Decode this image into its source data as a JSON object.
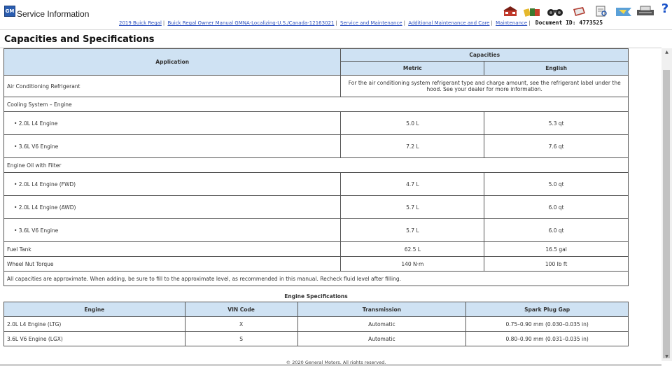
{
  "app": {
    "title": "Service Information",
    "logo": "GM"
  },
  "breadcrumb": {
    "items": [
      "2019 Buick Regal",
      "Buick Regal Owner Manual GMNA-Localizing-U.S./Canada-12163021",
      "Service and Maintenance",
      "Additional Maintenance and Care",
      "Maintenance"
    ],
    "doc_id": "Document ID: 4773525"
  },
  "toolbar": {
    "icons": [
      "home-icon",
      "books-icon",
      "binoculars-icon",
      "book-icon",
      "document-search-icon",
      "flag-icon",
      "printer-icon",
      "help-icon"
    ],
    "help_label": "?"
  },
  "page": {
    "title": "Capacities and Specifications"
  },
  "capacities": {
    "header_application": "Application",
    "header_capacities": "Capacities",
    "header_metric": "Metric",
    "header_english": "English",
    "ac": {
      "label": "Air Conditioning Refrigerant",
      "note": "For the air conditioning system refrigerant type and charge amount, see the refrigerant label under the hood. See your dealer for more information."
    },
    "cooling": {
      "label": "Cooling System – Engine",
      "rows": [
        {
          "label": "• 2.0L L4 Engine",
          "metric": "5.0 L",
          "english": "5.3 qt"
        },
        {
          "label": "• 3.6L V6 Engine",
          "metric": "7.2 L",
          "english": "7.6 qt"
        }
      ]
    },
    "oil": {
      "label": "Engine Oil with Filter",
      "rows": [
        {
          "label": "• 2.0L L4 Engine (FWD)",
          "metric": "4.7 L",
          "english": "5.0 qt"
        },
        {
          "label": "• 2.0L L4 Engine (AWD)",
          "metric": "5.7 L",
          "english": "6.0 qt"
        },
        {
          "label": "• 3.6L V6 Engine",
          "metric": "5.7 L",
          "english": "6.0 qt"
        }
      ]
    },
    "fuel": {
      "label": "Fuel Tank",
      "metric": "62.5 L",
      "english": "16.5 gal"
    },
    "wheel": {
      "label": "Wheel Nut Torque",
      "metric": "140 N·m",
      "english": "100 lb ft"
    },
    "note": "All capacities are approximate. When adding, be sure to fill to the approximate level, as recommended in this manual. Recheck fluid level after filling."
  },
  "engine_specs": {
    "title": "Engine Specifications",
    "headers": [
      "Engine",
      "VIN Code",
      "Transmission",
      "Spark Plug Gap"
    ],
    "rows": [
      [
        "2.0L L4 Engine (LTG)",
        "X",
        "Automatic",
        "0.75–0.90 mm (0.030–0.035 in)"
      ],
      [
        "3.6L V6 Engine (LGX)",
        "S",
        "Automatic",
        "0.80–0.90 mm (0.031–0.035 in)"
      ]
    ]
  },
  "footer": {
    "text": "© 2020 General Motors.  All rights reserved."
  }
}
